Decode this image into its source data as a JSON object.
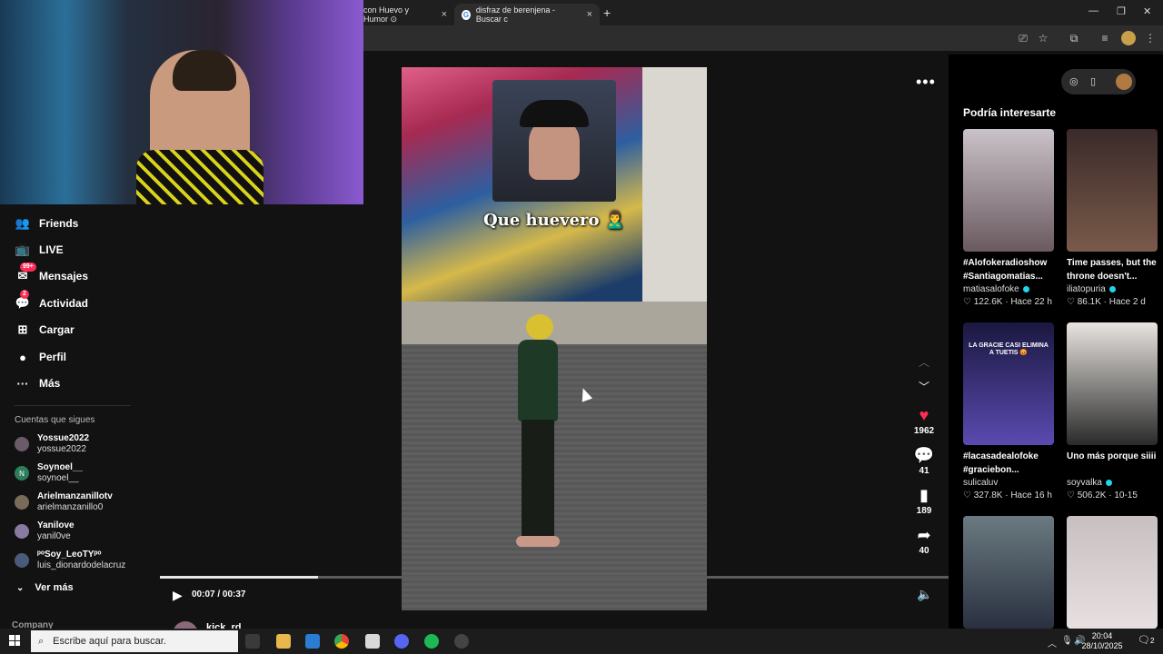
{
  "browser": {
    "tabs": [
      {
        "label": "con Huevo y Humor ⊙"
      },
      {
        "label": "disfraz de berenjena - Buscar c"
      }
    ],
    "new_tab": "+",
    "window_controls": {
      "minimize": "—",
      "restore": "❐",
      "close": "✕"
    }
  },
  "sidebar": {
    "items": [
      {
        "label": "Friends",
        "icon": "friends-icon",
        "glyph": "👥"
      },
      {
        "label": "LIVE",
        "icon": "live-icon",
        "glyph": "📺"
      },
      {
        "label": "Mensajes",
        "icon": "messages-icon",
        "glyph": "✉",
        "badge": "99+"
      },
      {
        "label": "Actividad",
        "icon": "activity-icon",
        "glyph": "💬",
        "badge": "2"
      },
      {
        "label": "Cargar",
        "icon": "upload-icon",
        "glyph": "⊞"
      },
      {
        "label": "Perfil",
        "icon": "profile-icon",
        "glyph": "●"
      },
      {
        "label": "Más",
        "icon": "more-icon",
        "glyph": "···"
      }
    ],
    "following_title": "Cuentas que sigues",
    "following": [
      {
        "name": "Yossue2022",
        "username": "yossue2022",
        "color": "#6a5a6a"
      },
      {
        "name": "Soynoel__",
        "username": "soynoel__",
        "color": "#2e7d5b",
        "initial": "N"
      },
      {
        "name": "Arielmanzanillotv",
        "username": "arielmanzanillo0",
        "color": "#7a6a5a"
      },
      {
        "name": "Yanilove",
        "username": "yanil0ve",
        "color": "#8a7aa0"
      },
      {
        "name": "ᵖᵒSoy_LeoTYᵖᵒ",
        "username": "luis_dionardodelacruz",
        "color": "#4a5a7a"
      }
    ],
    "see_more": "Ver más",
    "company": "Company"
  },
  "video": {
    "caption": "Que huevero 🙎‍♂️",
    "time": "00:07 / 00:37",
    "progress": 0.2,
    "author": "kick_rd",
    "actions": {
      "likes": "1962",
      "comments": "41",
      "saves": "189",
      "shares": "40"
    }
  },
  "recommendations": {
    "title": "Podría interesarte",
    "items": [
      {
        "caption": "#Alofokeradioshow #Santiagomatias...",
        "author": "matiasalofoke",
        "verified": true,
        "stats": "♡ 122.6K · Hace 22 h",
        "bg": "linear-gradient(180deg,#c9c2c8,#6a5a60)"
      },
      {
        "caption": "Time passes, but the throne doesn't...",
        "author": "iliatopuria",
        "verified": true,
        "stats": "♡ 86.1K · Hace 2 d",
        "bg": "linear-gradient(180deg,#3a2a2a,#7a5a4a)"
      },
      {
        "caption": "#lacasadealofoke #graciebon...",
        "author": "sulicaluv",
        "verified": false,
        "stats": "♡ 327.8K · Hace 16 h",
        "bg": "linear-gradient(180deg,#1a1840,#5a4ab0)",
        "overlay": "LA GRACIE CASI ELIMINA A TUETIS 😡"
      },
      {
        "caption": "Uno más porque siiii",
        "author": "soyvalka",
        "verified": true,
        "stats": "♡ 506.2K · 10-15",
        "bg": "linear-gradient(180deg,#e8e4e0,#2a2a2a)"
      },
      {
        "caption": "",
        "author": "",
        "verified": false,
        "stats": "",
        "bg": "linear-gradient(180deg,#6a7a80,#2a3040)"
      },
      {
        "caption": "",
        "author": "",
        "verified": false,
        "stats": "",
        "bg": "linear-gradient(180deg,#c8c0c0,#e8e0e0)"
      }
    ]
  },
  "taskbar": {
    "search_placeholder": "Escribe aquí para buscar.",
    "time": "20:04",
    "date": "28/10/2025",
    "notifications": "2"
  }
}
